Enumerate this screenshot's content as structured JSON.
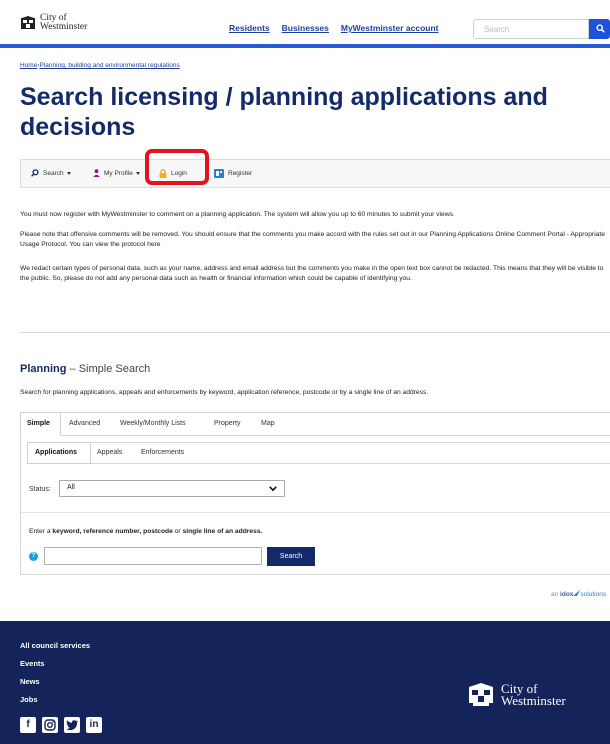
{
  "header": {
    "logo_line1": "City of",
    "logo_line2": "Westminster",
    "nav": [
      "Residents",
      "Businesses",
      "MyWestminster account"
    ],
    "search_placeholder": "Search"
  },
  "breadcrumb": {
    "home": "Home",
    "separator": "›",
    "current": "Planning, building and environmental regulations"
  },
  "page_title": "Search licensing / planning applications and decisions",
  "toolbar": {
    "search": "Search",
    "my_profile": "My Profile",
    "login": "Login",
    "register": "Register"
  },
  "notices": [
    "You must now register with MyWestminster to comment on a planning application. The system will allow you up to 60 minutes to submit your views.",
    "Please note that offensive comments will be removed. You should ensure that the comments you make accord with the rules set out in our Planning Applications Online Comment Portal - Appropriate Usage Protocol. You can view the protocol here",
    "We redact certain types of personal data, such as your name, address and email address but the comments you make in the open text box cannot be redacted. This means that they will be visible to the public. So, please do not add any personal data such as health or financial information which could be capable of identifying you."
  ],
  "planning": {
    "heading": "Planning",
    "subheading": "– Simple Search",
    "description": "Search for planning applications, appeals and enforcements by keyword, application reference, postcode or by a single line of an address.",
    "tabs": [
      "Simple",
      "Advanced",
      "Weekly/Monthly Lists",
      "Property",
      "Map"
    ],
    "subtabs": [
      "Applications",
      "Appeals",
      "Enforcements"
    ],
    "status_label": "Status:",
    "status_value": "All",
    "enter_prefix": "Enter a ",
    "enter_keyword": "keyword, reference number, postcode",
    "enter_or": " or ",
    "enter_address": "single line of an address.",
    "search_button": "Search",
    "help_glyph": "?"
  },
  "idox": {
    "prefix": "an",
    "brand": "idox",
    "suffix": "solutions"
  },
  "footer": {
    "links": [
      "All council services",
      "Events",
      "News",
      "Jobs"
    ],
    "social": [
      "facebook-icon",
      "instagram-icon",
      "twitter-icon",
      "linkedin-icon"
    ],
    "logo_line1": "City of",
    "logo_line2": "Westminster"
  },
  "colors": {
    "title_navy": "#142b6a",
    "link_blue": "#1f3f9e",
    "accent_blue": "#2a5bd7",
    "highlight_red": "#e3141f",
    "footer_navy": "#14235a"
  }
}
